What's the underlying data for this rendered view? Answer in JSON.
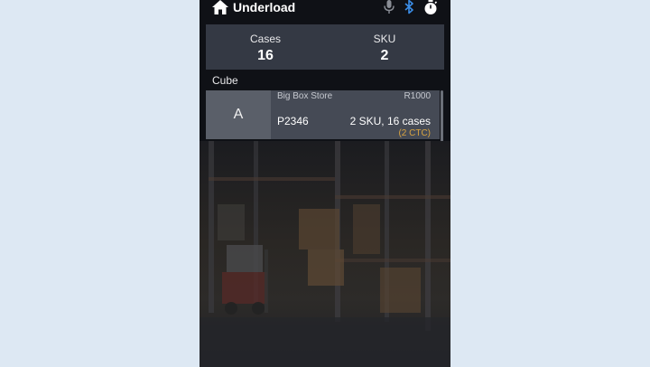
{
  "header": {
    "title": "Underload",
    "icons": [
      "home-icon",
      "microphone-icon",
      "bluetooth-icon",
      "timer-icon"
    ],
    "bluetooth_color": "#3b8ee8"
  },
  "stats": {
    "cases_label": "Cases",
    "cases_value": "16",
    "sku_label": "SKU",
    "sku_value": "2"
  },
  "section_label": "Cube",
  "order": {
    "cube": "A",
    "store": "Big Box Store",
    "route": "R1000",
    "id": "P2346",
    "summary": "2 SKU, 16 cases",
    "ctc": "(2 CTC)",
    "ctc_color": "#d9a441"
  }
}
